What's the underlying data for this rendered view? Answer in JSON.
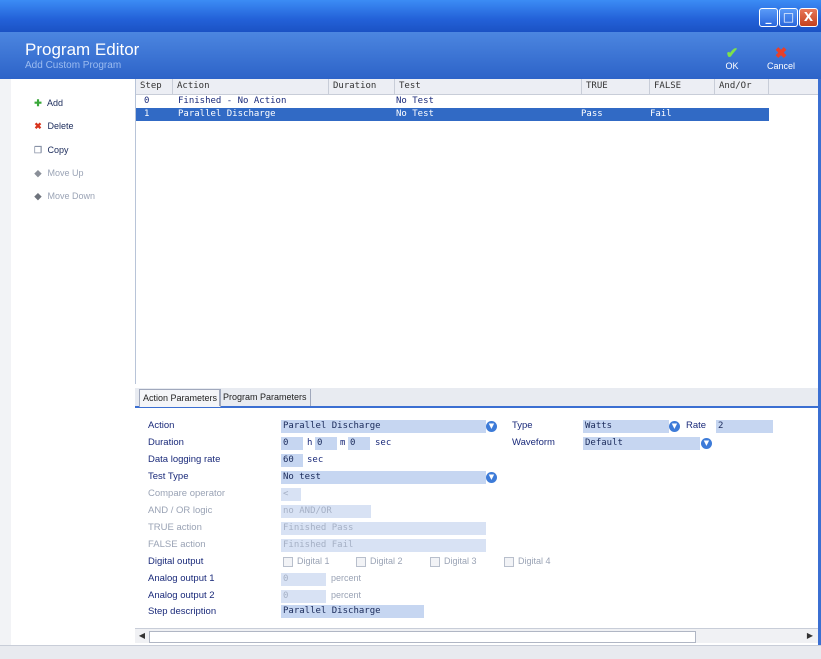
{
  "window": {
    "title": "Program Editor",
    "subtitle": "Add Custom Program",
    "controls": {
      "minimize": "_",
      "maximize": "□",
      "close": "X"
    }
  },
  "header_buttons": {
    "ok_label": "OK",
    "cancel_label": "Cancel"
  },
  "sidebar": {
    "items": [
      {
        "label": "Add",
        "icon": "plus-icon",
        "enabled": true
      },
      {
        "label": "Delete",
        "icon": "delete-x-icon",
        "enabled": true
      },
      {
        "label": "Copy",
        "icon": "copy-icon",
        "enabled": true
      },
      {
        "label": "Move Up",
        "icon": "arrow-up-icon",
        "enabled": false
      },
      {
        "label": "Move Down",
        "icon": "arrow-down-icon",
        "enabled": false
      }
    ]
  },
  "table": {
    "columns": [
      "Step",
      "Action",
      "Duration",
      "Test",
      "TRUE",
      "FALSE",
      "And/Or"
    ],
    "rows": [
      {
        "step": "0",
        "action": "Finished - No Action",
        "duration": "",
        "test": "No Test",
        "true": "",
        "false": "",
        "andor": "",
        "selected": false
      },
      {
        "step": "1",
        "action": "Parallel Discharge",
        "duration": "",
        "test": "No Test",
        "true": "Pass",
        "false": "Fail",
        "andor": "",
        "selected": true
      }
    ]
  },
  "tabs": [
    {
      "label": "Action Parameters",
      "active": true
    },
    {
      "label": "Program Parameters",
      "active": false
    }
  ],
  "params": {
    "action_label": "Action",
    "action_value": "Parallel Discharge",
    "type_label": "Type",
    "type_value": "Watts",
    "rate_label": "Rate",
    "rate_value": "2",
    "duration_label": "Duration",
    "duration_h": "0",
    "duration_h_unit": "h",
    "duration_m": "0",
    "duration_m_unit": "m",
    "duration_s": "0",
    "duration_s_unit": "sec",
    "waveform_label": "Waveform",
    "waveform_value": "Default",
    "logging_label": "Data logging rate",
    "logging_value": "60",
    "logging_unit": "sec",
    "testtype_label": "Test Type",
    "testtype_value": "No test",
    "compare_label": "Compare operator",
    "compare_value": "<",
    "andor_label": "AND / OR logic",
    "andor_value": "no AND/OR",
    "true_label": "TRUE action",
    "true_value": "Finished Pass",
    "false_label": "FALSE action",
    "false_value": "Finished Fail",
    "digital_label": "Digital output",
    "digital_items": [
      "Digital 1",
      "Digital 2",
      "Digital 3",
      "Digital 4"
    ],
    "analog1_label": "Analog output 1",
    "analog1_value": "0",
    "analog1_unit": "percent",
    "analog2_label": "Analog output 2",
    "analog2_value": "0",
    "analog2_unit": "percent",
    "stepdesc_label": "Step description",
    "stepdesc_value": "Parallel Discharge"
  },
  "colors": {
    "titlebar": "#2361d8",
    "selection": "#316ac5",
    "field_bg": "#c6d6f1",
    "label_text": "#1a2a7a"
  }
}
